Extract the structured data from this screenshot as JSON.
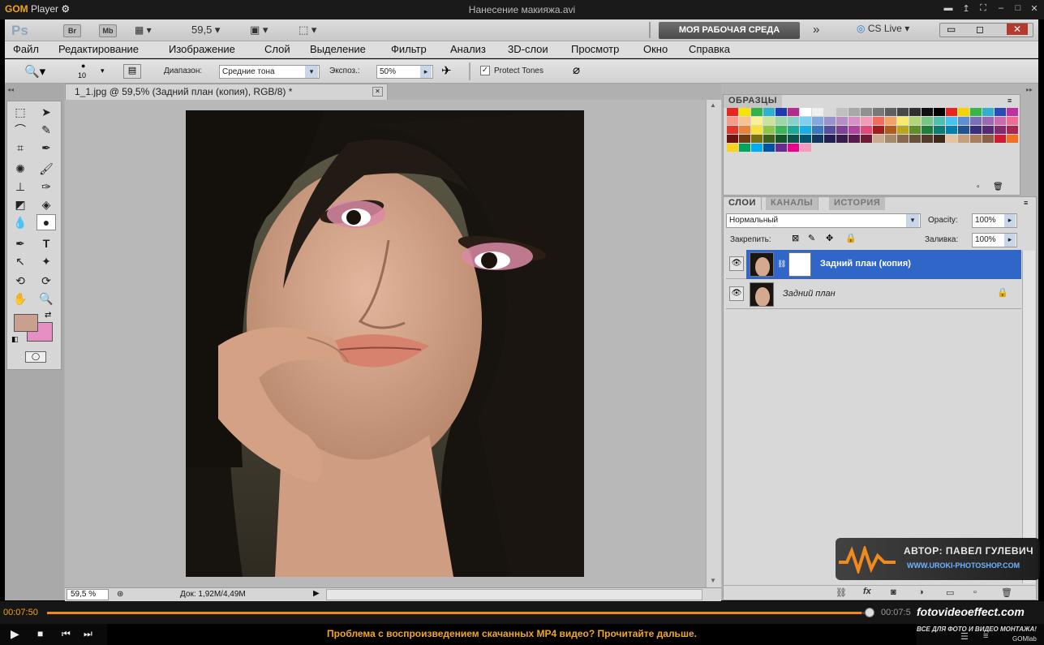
{
  "gom": {
    "logo": "GOM",
    "logo_suffix": "Player",
    "title": "Нанесение макияжа.avi",
    "time_elapsed": "00:07:50",
    "time_total": "00:07:5",
    "progress": 0.99,
    "notice": "Проблема с воспроизведением скачанных MP4 видео? Прочитайте дальше.",
    "brand": "fotovideoeffect.com",
    "brand_sub": "ВСЕ ДЛЯ ФОТО И ВИДЕО МОНТАЖА!",
    "gomlab": "GOMlab"
  },
  "ps": {
    "logo": "Ps",
    "br": "Br",
    "mb": "Mb",
    "zoom": "59,5",
    "workspace": "МОЯ РАБОЧАЯ СРЕДА",
    "cslive": "CS Live",
    "menu": [
      "Файл",
      "Редактирование",
      "Изображение",
      "Слой",
      "Выделение",
      "Фильтр",
      "Анализ",
      "3D-слои",
      "Просмотр",
      "Окно",
      "Справка"
    ],
    "options": {
      "brush_size": "10",
      "range_label": "Диапазон:",
      "range_value": "Средние тона",
      "exposure_label": "Экспоз.:",
      "exposure_value": "50%",
      "protect": "Protect Tones"
    },
    "doc_tab": "1_1.jpg @ 59,5% (Задний план (копия), RGB/8) *",
    "status_zoom": "59,5 %",
    "status_doc": "Док: 1,92M/4,49M",
    "swatches_tab": "ОБРАЗЦЫ",
    "layer_tabs": [
      "СЛОИ",
      "КАНАЛЫ",
      "ИСТОРИЯ"
    ],
    "blend": "Нормальный",
    "opacity_label": "Opacity:",
    "opacity": "100%",
    "lock_label": "Закрепить:",
    "fill_label": "Заливка:",
    "fill": "100%",
    "layers": [
      {
        "name": "Задний план (копия)",
        "selected": true
      },
      {
        "name": "Задний план",
        "selected": false
      }
    ],
    "watermark_author": "АВТОР: ПАВЕЛ ГУЛЕВИЧ",
    "watermark_url": "WWW.UROKI-PHOTOSHOP.COM",
    "colors": {
      "fg": "#c9a08e",
      "bg": "#e58fc4",
      "selected_layer": "#2f66c8"
    }
  }
}
